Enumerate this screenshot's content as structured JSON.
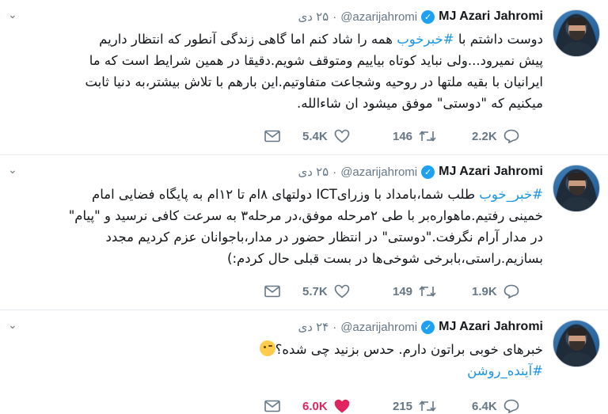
{
  "tweets": [
    {
      "name": "MJ Azari Jahromi",
      "handle": "@azarijahromi",
      "date": "۲۵ دی",
      "lines": [
        {
          "pre": "دوست داشتم با ",
          "tag": "#خبرخوب",
          "post": " همه را شاد کنم اما گاهی زندگی آنطور که انتظار داریم"
        },
        {
          "pre": "پیش نمیرود...ولی نباید کوتاه بیاییم ومتوقف شویم.دقیقا در همین شرایط است که ما",
          "tag": "",
          "post": ""
        },
        {
          "pre": "ایرانیان با بقیه ملتها در روحیه وشجاعت متفاوتیم.این بارهم با تلاش بیشتر،به دنیا ثابت",
          "tag": "",
          "post": ""
        },
        {
          "pre": "میکنیم که \"دوستی\" موفق میشود ان شاءالله.",
          "tag": "",
          "post": ""
        }
      ],
      "likes": "5.4K",
      "retweets": "146",
      "replies": "2.2K",
      "liked": false
    },
    {
      "name": "MJ Azari Jahromi",
      "handle": "@azarijahromi",
      "date": "۲۵ دی",
      "lines": [
        {
          "pre": "",
          "tag": "#خبر_خوب",
          "post": " طلب شما،بامداد با وزرایICT دولتهای ۸ام تا ۱۲ام به پایگاه فضایی امام"
        },
        {
          "pre": "خمینی رفتیم.ماهواره‌بر با طی ۲مرحله موفق،در مرحله۳ به سرعت کافی نرسید و \"پیام\"",
          "tag": "",
          "post": ""
        },
        {
          "pre": "در مدار آرام نگرفت.\"دوستی\" در انتظار حضور در مدار،باجوانان عزم کردیم مجدد",
          "tag": "",
          "post": ""
        },
        {
          "pre": "بسازیم.راستی،بابرخی شوخی‌ها در بست قبلی حال کردم:)",
          "tag": "",
          "post": ""
        }
      ],
      "likes": "5.7K",
      "retweets": "149",
      "replies": "1.9K",
      "liked": false
    },
    {
      "name": "MJ Azari Jahromi",
      "handle": "@azarijahromi",
      "date": "۲۴ دی",
      "lines": [
        {
          "pre": "خبرهای خوبی براتون دارم. حدس بزنید چی شده؟",
          "tag": "",
          "post": ""
        },
        {
          "pre": "",
          "tag": "#آینده_روشن",
          "post": ""
        }
      ],
      "likes": "6.0K",
      "retweets": "215",
      "replies": "6.4K",
      "liked": true
    }
  ],
  "icons": {
    "verified": "verified-badge-icon",
    "caret": "chevron-down-icon",
    "mail": "mail-icon",
    "like": "heart-icon",
    "retweet": "retweet-icon",
    "reply": "reply-icon",
    "emoji": "winking-face-emoji"
  },
  "colors": {
    "hashtag": "#1b95e0",
    "verified": "#1da1f2",
    "liked": "#e0245e",
    "muted": "#657786"
  }
}
